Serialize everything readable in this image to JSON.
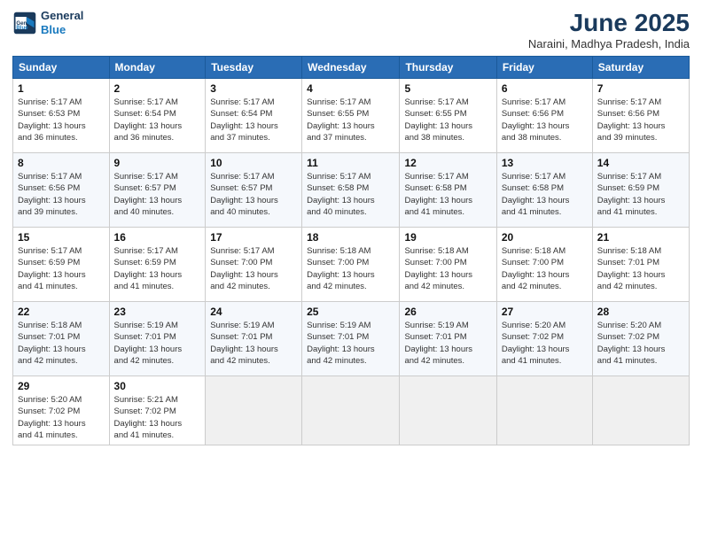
{
  "header": {
    "logo_line1": "General",
    "logo_line2": "Blue",
    "month": "June 2025",
    "location": "Naraini, Madhya Pradesh, India"
  },
  "weekdays": [
    "Sunday",
    "Monday",
    "Tuesday",
    "Wednesday",
    "Thursday",
    "Friday",
    "Saturday"
  ],
  "weeks": [
    [
      {
        "day": 1,
        "info": "Sunrise: 5:17 AM\nSunset: 6:53 PM\nDaylight: 13 hours\nand 36 minutes."
      },
      {
        "day": 2,
        "info": "Sunrise: 5:17 AM\nSunset: 6:54 PM\nDaylight: 13 hours\nand 36 minutes."
      },
      {
        "day": 3,
        "info": "Sunrise: 5:17 AM\nSunset: 6:54 PM\nDaylight: 13 hours\nand 37 minutes."
      },
      {
        "day": 4,
        "info": "Sunrise: 5:17 AM\nSunset: 6:55 PM\nDaylight: 13 hours\nand 37 minutes."
      },
      {
        "day": 5,
        "info": "Sunrise: 5:17 AM\nSunset: 6:55 PM\nDaylight: 13 hours\nand 38 minutes."
      },
      {
        "day": 6,
        "info": "Sunrise: 5:17 AM\nSunset: 6:56 PM\nDaylight: 13 hours\nand 38 minutes."
      },
      {
        "day": 7,
        "info": "Sunrise: 5:17 AM\nSunset: 6:56 PM\nDaylight: 13 hours\nand 39 minutes."
      }
    ],
    [
      {
        "day": 8,
        "info": "Sunrise: 5:17 AM\nSunset: 6:56 PM\nDaylight: 13 hours\nand 39 minutes."
      },
      {
        "day": 9,
        "info": "Sunrise: 5:17 AM\nSunset: 6:57 PM\nDaylight: 13 hours\nand 40 minutes."
      },
      {
        "day": 10,
        "info": "Sunrise: 5:17 AM\nSunset: 6:57 PM\nDaylight: 13 hours\nand 40 minutes."
      },
      {
        "day": 11,
        "info": "Sunrise: 5:17 AM\nSunset: 6:58 PM\nDaylight: 13 hours\nand 40 minutes."
      },
      {
        "day": 12,
        "info": "Sunrise: 5:17 AM\nSunset: 6:58 PM\nDaylight: 13 hours\nand 41 minutes."
      },
      {
        "day": 13,
        "info": "Sunrise: 5:17 AM\nSunset: 6:58 PM\nDaylight: 13 hours\nand 41 minutes."
      },
      {
        "day": 14,
        "info": "Sunrise: 5:17 AM\nSunset: 6:59 PM\nDaylight: 13 hours\nand 41 minutes."
      }
    ],
    [
      {
        "day": 15,
        "info": "Sunrise: 5:17 AM\nSunset: 6:59 PM\nDaylight: 13 hours\nand 41 minutes."
      },
      {
        "day": 16,
        "info": "Sunrise: 5:17 AM\nSunset: 6:59 PM\nDaylight: 13 hours\nand 41 minutes."
      },
      {
        "day": 17,
        "info": "Sunrise: 5:17 AM\nSunset: 7:00 PM\nDaylight: 13 hours\nand 42 minutes."
      },
      {
        "day": 18,
        "info": "Sunrise: 5:18 AM\nSunset: 7:00 PM\nDaylight: 13 hours\nand 42 minutes."
      },
      {
        "day": 19,
        "info": "Sunrise: 5:18 AM\nSunset: 7:00 PM\nDaylight: 13 hours\nand 42 minutes."
      },
      {
        "day": 20,
        "info": "Sunrise: 5:18 AM\nSunset: 7:00 PM\nDaylight: 13 hours\nand 42 minutes."
      },
      {
        "day": 21,
        "info": "Sunrise: 5:18 AM\nSunset: 7:01 PM\nDaylight: 13 hours\nand 42 minutes."
      }
    ],
    [
      {
        "day": 22,
        "info": "Sunrise: 5:18 AM\nSunset: 7:01 PM\nDaylight: 13 hours\nand 42 minutes."
      },
      {
        "day": 23,
        "info": "Sunrise: 5:19 AM\nSunset: 7:01 PM\nDaylight: 13 hours\nand 42 minutes."
      },
      {
        "day": 24,
        "info": "Sunrise: 5:19 AM\nSunset: 7:01 PM\nDaylight: 13 hours\nand 42 minutes."
      },
      {
        "day": 25,
        "info": "Sunrise: 5:19 AM\nSunset: 7:01 PM\nDaylight: 13 hours\nand 42 minutes."
      },
      {
        "day": 26,
        "info": "Sunrise: 5:19 AM\nSunset: 7:01 PM\nDaylight: 13 hours\nand 42 minutes."
      },
      {
        "day": 27,
        "info": "Sunrise: 5:20 AM\nSunset: 7:02 PM\nDaylight: 13 hours\nand 41 minutes."
      },
      {
        "day": 28,
        "info": "Sunrise: 5:20 AM\nSunset: 7:02 PM\nDaylight: 13 hours\nand 41 minutes."
      }
    ],
    [
      {
        "day": 29,
        "info": "Sunrise: 5:20 AM\nSunset: 7:02 PM\nDaylight: 13 hours\nand 41 minutes."
      },
      {
        "day": 30,
        "info": "Sunrise: 5:21 AM\nSunset: 7:02 PM\nDaylight: 13 hours\nand 41 minutes."
      },
      null,
      null,
      null,
      null,
      null
    ]
  ]
}
